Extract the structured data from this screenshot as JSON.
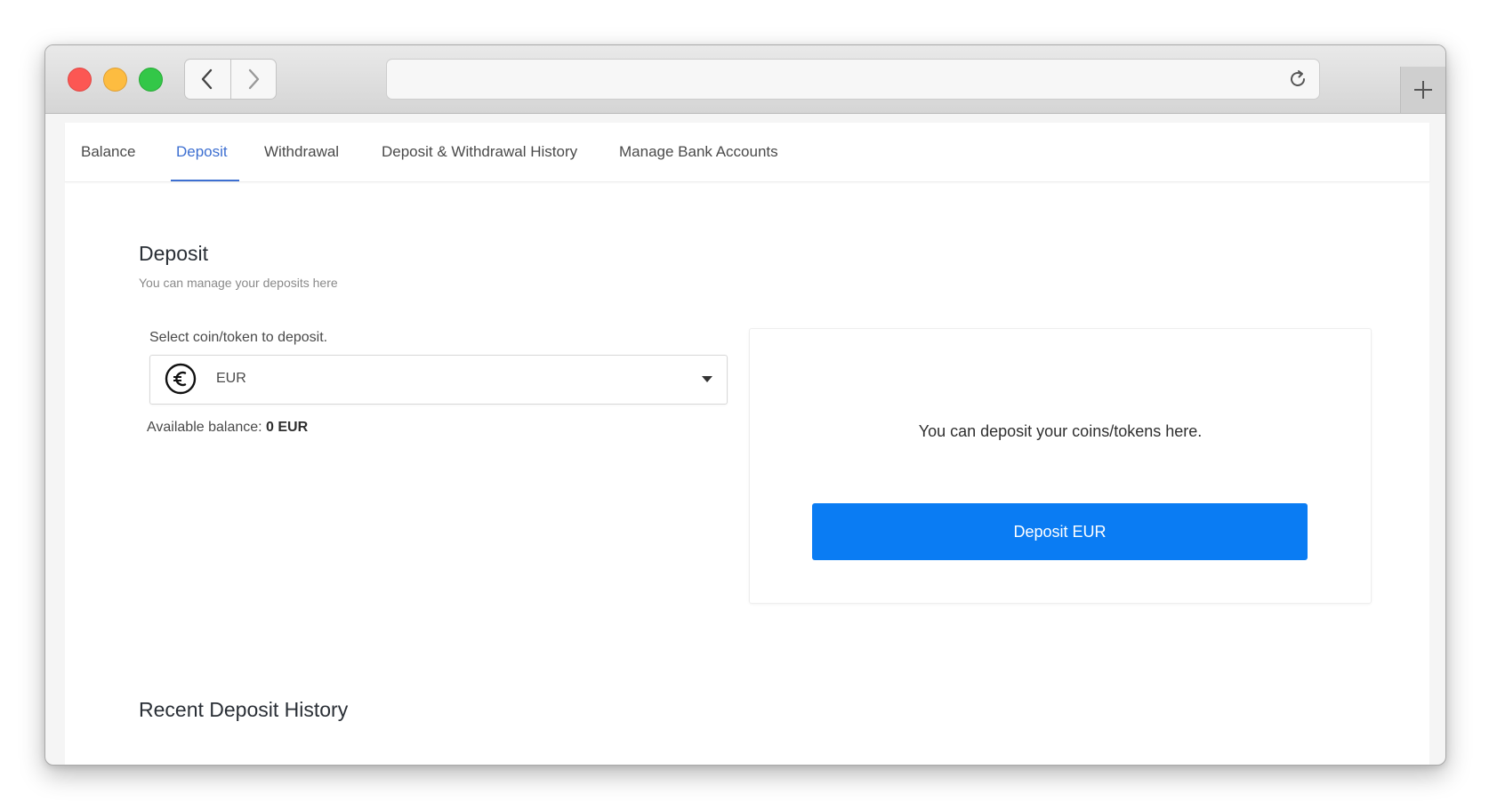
{
  "browser": {
    "address": ""
  },
  "tabs": [
    {
      "label": "Balance"
    },
    {
      "label": "Deposit"
    },
    {
      "label": "Withdrawal"
    },
    {
      "label": "Deposit & Withdrawal History"
    },
    {
      "label": "Manage Bank Accounts"
    }
  ],
  "active_tab": "Deposit",
  "page": {
    "title": "Deposit",
    "subtitle": "You can manage your deposits here"
  },
  "selector": {
    "label": "Select coin/token to deposit.",
    "value": "EUR",
    "icon": "euro-icon"
  },
  "balance": {
    "label": "Available balance:",
    "value": "0 EUR"
  },
  "card": {
    "text": "You can deposit your coins/tokens here.",
    "button_label": "Deposit EUR"
  },
  "history": {
    "title": "Recent Deposit History"
  },
  "colors": {
    "accent": "#3d6fd1",
    "button": "#0a7cf3"
  }
}
